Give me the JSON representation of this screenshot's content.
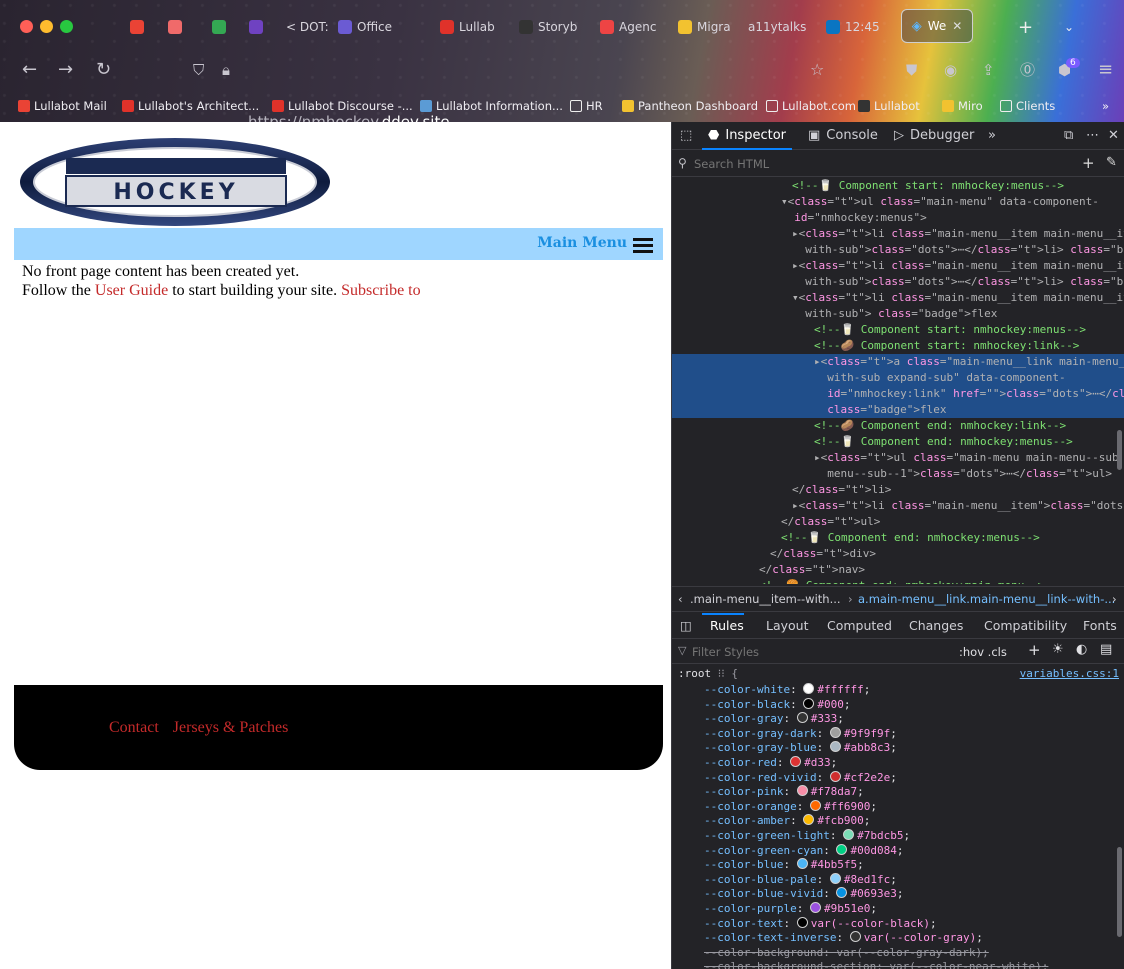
{
  "browser": {
    "tabs": [
      {
        "label": "",
        "icon": "gmail-icon",
        "color": "#ea4335"
      },
      {
        "label": "",
        "icon": "asana-icon",
        "color": "#f06a6a"
      },
      {
        "label": "",
        "icon": "drive-icon",
        "color": "#34a853"
      },
      {
        "label": "",
        "icon": "app-icon",
        "color": "#6f42c1"
      },
      {
        "label": "< DOT:",
        "icon": "",
        "color": ""
      },
      {
        "label": "Office",
        "icon": "office-icon",
        "color": "#6b5bd3"
      },
      {
        "label": "Lullab",
        "icon": "lullabot-icon",
        "color": "#e0322a"
      },
      {
        "label": "Storyb",
        "icon": "github-icon",
        "color": "#333333"
      },
      {
        "label": "Agenc",
        "icon": "agency-icon",
        "color": "#e44"
      },
      {
        "label": "Migra",
        "icon": "notes-icon",
        "color": "#f2c230"
      },
      {
        "label": "a11ytalks",
        "icon": "",
        "color": ""
      },
      {
        "label": "12:45",
        "icon": "drupal-icon",
        "color": "#0a75c2"
      }
    ],
    "active_tab": "We",
    "url_prefix": "https://nmhockey.",
    "url_domain": "ddev.site",
    "extension_badge": "6",
    "bookmarks": [
      "Lullabot Mail",
      "Lullabot's Architect...",
      "Lullabot Discourse -...",
      "Lullabot Information...",
      "HR",
      "Pantheon Dashboard",
      "Lullabot.com",
      "Lullabot",
      "Miro",
      "Clients"
    ]
  },
  "site": {
    "logo_text": "NM HOCKEY",
    "menu_label": "Main Menu",
    "content_line1": "No front page content has been created yet.",
    "content_line2_pre": "Follow the ",
    "content_link1": "User Guide",
    "content_line2_mid": " to start building your site. ",
    "content_link2": "Subscribe to",
    "footer_links": [
      "Contact",
      "Jerseys & Patches"
    ]
  },
  "devtools": {
    "tabs": [
      "Inspector",
      "Console",
      "Debugger"
    ],
    "search_placeholder": "Search HTML",
    "tree": [
      {
        "indent": 10,
        "html": "c:<!--🥛 Component start: nmhockey:menus-->"
      },
      {
        "indent": 9,
        "html": "▾<ul class=\"main-menu\" data-component-"
      },
      {
        "indent": 9,
        "html": "  id=\"nmhockey:menus\">"
      },
      {
        "indent": 10,
        "html": "▸<li class=\"main-menu__item main-menu__item--"
      },
      {
        "indent": 10,
        "html": "  with-sub\">⋯</li> [flex]"
      },
      {
        "indent": 10,
        "html": "▸<li class=\"main-menu__item main-menu__item--"
      },
      {
        "indent": 10,
        "html": "  with-sub\">⋯</li> [flex]"
      },
      {
        "indent": 10,
        "html": "▾<li class=\"main-menu__item main-menu__item--"
      },
      {
        "indent": 10,
        "html": "  with-sub\"> [flex]"
      },
      {
        "indent": 12,
        "html": "c:<!--🥛 Component start: nmhockey:menus-->"
      },
      {
        "indent": 12,
        "html": "c:<!--🥔 Component start: nmhockey:link-->"
      },
      {
        "indent": 12,
        "html": "▸<a class=\"main-menu__link main-menu__link--"
      },
      {
        "indent": 12,
        "html": "  with-sub expand-sub\" data-component-"
      },
      {
        "indent": 12,
        "html": "  id=\"nmhockey:link\" href=\"\">⋯</a> [event]"
      },
      {
        "indent": 12,
        "html": "  [flex]"
      },
      {
        "indent": 12,
        "html": "c:<!--🥔 Component end: nmhockey:link-->"
      },
      {
        "indent": 12,
        "html": "c:<!--🥛 Component end: nmhockey:menus-->"
      },
      {
        "indent": 12,
        "html": "▸<ul class=\"main-menu main-menu--sub main-"
      },
      {
        "indent": 12,
        "html": "  menu--sub--1\">⋯</ul>"
      },
      {
        "indent": 10,
        "html": "</li>"
      },
      {
        "indent": 10,
        "html": "▸<li class=\"main-menu__item\">⋯</li> [flex]"
      },
      {
        "indent": 9,
        "html": "</ul>"
      },
      {
        "indent": 9,
        "html": "c:<!--🥛 Component end: nmhockey:menus-->"
      },
      {
        "indent": 8,
        "html": "</div>"
      },
      {
        "indent": 7,
        "html": "</nav>"
      },
      {
        "indent": 7,
        "html": "c:<!--🍔 Component end: nmhockey:main-menu-->"
      }
    ],
    "breadcrumb_1": ".main-menu__item--with...",
    "breadcrumb_2": "a.main-menu__link.main-menu__link--with-...",
    "rule_tabs": [
      "Rules",
      "Layout",
      "Computed",
      "Changes",
      "Compatibility",
      "Fonts"
    ],
    "filter_placeholder": "Filter Styles",
    "filter_toggles": ":hov .cls",
    "rule_selector": ":root",
    "rule_source": "variables.css:1",
    "vars": [
      {
        "name": "--color-white",
        "value": "#ffffff",
        "swatch": "#ffffff",
        "strike": false
      },
      {
        "name": "--color-black",
        "value": "#000",
        "swatch": "#000000",
        "strike": false
      },
      {
        "name": "--color-gray",
        "value": "#333",
        "swatch": "#333333",
        "strike": false
      },
      {
        "name": "--color-gray-dark",
        "value": "#9f9f9f",
        "swatch": "#9f9f9f",
        "strike": false
      },
      {
        "name": "--color-gray-blue",
        "value": "#abb8c3",
        "swatch": "#abb8c3",
        "strike": false
      },
      {
        "name": "--color-red",
        "value": "#d33",
        "swatch": "#dd3333",
        "strike": false
      },
      {
        "name": "--color-red-vivid",
        "value": "#cf2e2e",
        "swatch": "#cf2e2e",
        "strike": false
      },
      {
        "name": "--color-pink",
        "value": "#f78da7",
        "swatch": "#f78da7",
        "strike": false
      },
      {
        "name": "--color-orange",
        "value": "#ff6900",
        "swatch": "#ff6900",
        "strike": false
      },
      {
        "name": "--color-amber",
        "value": "#fcb900",
        "swatch": "#fcb900",
        "strike": false
      },
      {
        "name": "--color-green-light",
        "value": "#7bdcb5",
        "swatch": "#7bdcb5",
        "strike": false
      },
      {
        "name": "--color-green-cyan",
        "value": "#00d084",
        "swatch": "#00d084",
        "strike": false
      },
      {
        "name": "--color-blue",
        "value": "#4bb5f5",
        "swatch": "#4bb5f5",
        "strike": false
      },
      {
        "name": "--color-blue-pale",
        "value": "#8ed1fc",
        "swatch": "#8ed1fc",
        "strike": false
      },
      {
        "name": "--color-blue-vivid",
        "value": "#0693e3",
        "swatch": "#0693e3",
        "strike": false
      },
      {
        "name": "--color-purple",
        "value": "#9b51e0",
        "swatch": "#9b51e0",
        "strike": false
      },
      {
        "name": "--color-text",
        "value": "var(--color-black)",
        "swatch": "#000000",
        "strike": false
      },
      {
        "name": "--color-text-inverse",
        "value": "var(--color-gray)",
        "swatch": "#333333",
        "strike": false
      },
      {
        "name": "--color-background",
        "value": "var(--color-gray-dark)",
        "swatch": "",
        "strike": true
      },
      {
        "name": "--color-background-section",
        "value": "var(--color-near-white)",
        "swatch": "",
        "strike": true
      }
    ]
  }
}
